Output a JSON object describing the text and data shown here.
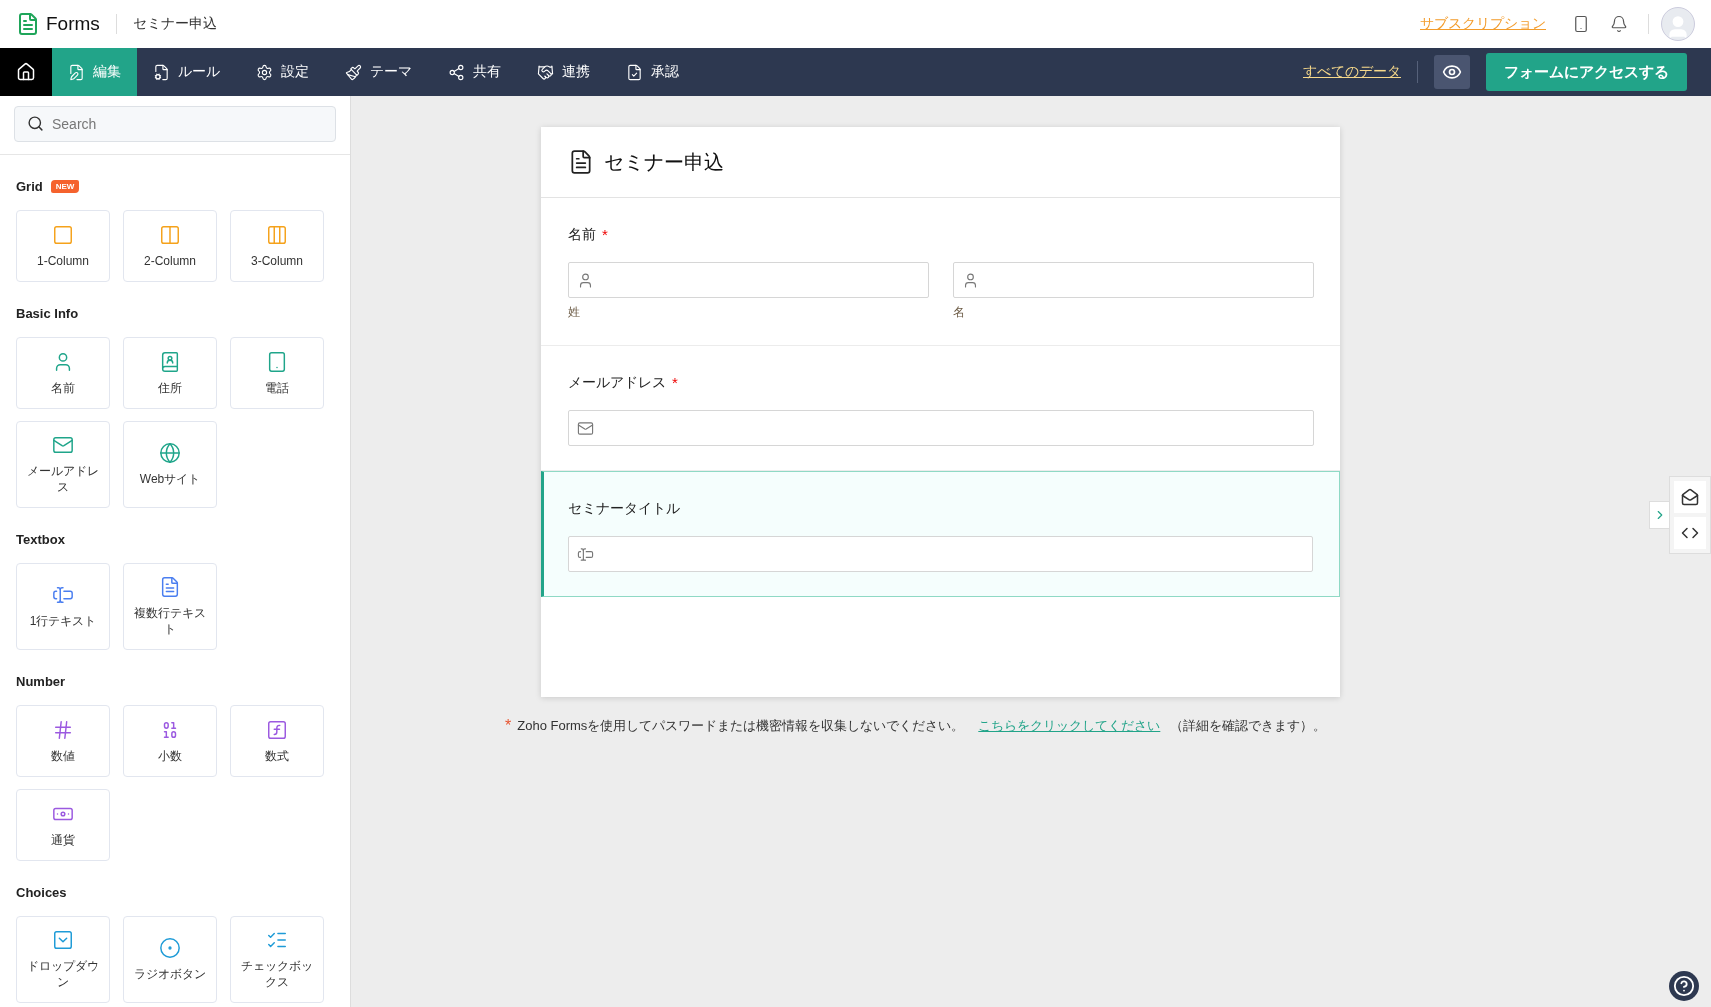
{
  "header": {
    "app_name": "Forms",
    "form_name": "セミナー申込",
    "subscription_link": "サブスクリプション"
  },
  "nav": {
    "items": [
      {
        "label": "編集",
        "selected": true
      },
      {
        "label": "ルール",
        "selected": false
      },
      {
        "label": "設定",
        "selected": false
      },
      {
        "label": "テーマ",
        "selected": false
      },
      {
        "label": "共有",
        "selected": false
      },
      {
        "label": "連携",
        "selected": false
      },
      {
        "label": "承認",
        "selected": false
      }
    ],
    "all_data_link": "すべてのデータ",
    "access_button": "フォームにアクセスする"
  },
  "sidebar": {
    "search": {
      "placeholder": "Search"
    },
    "sections": [
      {
        "title": "Grid",
        "badge": "NEW",
        "items": [
          "1-Column",
          "2-Column",
          "3-Column"
        ]
      },
      {
        "title": "Basic Info",
        "items": [
          "名前",
          "住所",
          "電話",
          "メールアドレス",
          "Webサイト"
        ]
      },
      {
        "title": "Textbox",
        "items": [
          "1行テキスト",
          "複数行テキスト"
        ]
      },
      {
        "title": "Number",
        "items": [
          "数値",
          "小数",
          "数式",
          "通貨"
        ]
      },
      {
        "title": "Choices",
        "items": [
          "ドロップダウン",
          "ラジオボタン",
          "チェックボックス"
        ]
      }
    ]
  },
  "form": {
    "title": "セミナー申込",
    "fields": [
      {
        "kind": "name",
        "label": "名前",
        "required_mark": "*",
        "selected": false,
        "subfields": [
          {
            "caption": "姓"
          },
          {
            "caption": "名"
          }
        ]
      },
      {
        "kind": "email",
        "label": "メールアドレス",
        "required_mark": "*",
        "selected": false
      },
      {
        "kind": "single_line",
        "label": "セミナータイトル",
        "selected": true
      }
    ]
  },
  "notice": {
    "mark": "*",
    "text": "Zoho Formsを使用してパスワードまたは機密情報を収集しないでください。",
    "link": "こちらをクリックしてください",
    "suffix": "（詳細を確認できます）。"
  }
}
